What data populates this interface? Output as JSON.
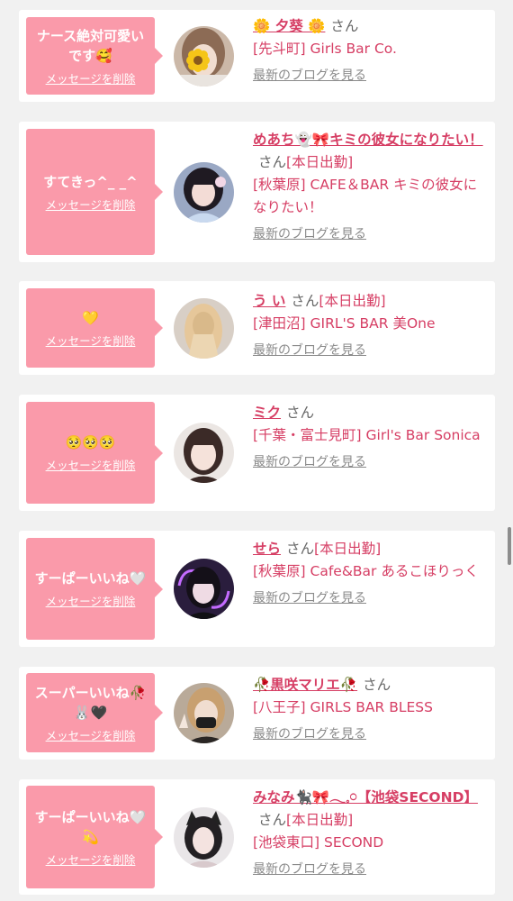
{
  "ui": {
    "delete_label": "メッセージを削除",
    "blog_label": "最新のブログを見る",
    "san": "さん",
    "today_badge": "[本日出勤]"
  },
  "colors": {
    "background": "#f1f1f1",
    "bubble": "#fa9aaa",
    "accent": "#d63e64",
    "muted": "#8a8a8a"
  },
  "items": [
    {
      "message": "ナース絶対可愛いです🥰",
      "name": "🌼 夕葵 🌼",
      "badge": "",
      "shop": "[先斗町] Girls Bar Co.",
      "avatar_icon": "flower-avatar"
    },
    {
      "message": "すてきっ^_ _^",
      "name": "めあち👻🎀キミの彼女になりたい！",
      "badge": "[本日出勤]",
      "shop": "[秋葉原] CAFE＆BAR キミの彼女になりたい！",
      "avatar_icon": "dark-hair-avatar"
    },
    {
      "message": "💛",
      "name": "う い",
      "badge": "[本日出勤]",
      "shop": "[津田沼] GIRL'S BAR 美One",
      "avatar_icon": "blonde-avatar"
    },
    {
      "message": "🥺🥺🥺",
      "name": "ミク",
      "badge": "",
      "shop": "[千葉・富士見町] Girl's Bar Sonica",
      "avatar_icon": "portrait-avatar"
    },
    {
      "message": "すーぱーいいね🤍",
      "name": "せら",
      "badge": "[本日出勤]",
      "shop": "[秋葉原] Cafe&Bar あるこほりっく",
      "avatar_icon": "purple-light-avatar"
    },
    {
      "message": "スーパーいいね🥀🐰🖤",
      "name": "🥀黒咲マリエ🥀",
      "badge": "",
      "shop": "[八王子] GIRLS BAR BLESS",
      "avatar_icon": "masked-avatar"
    },
    {
      "message": "すーぱーいいね🤍💫",
      "name": "みなみ🐈‍⬛🎀𓂃𓈒𓏸【池袋SECOND】",
      "badge": "[本日出勤]",
      "shop": "[池袋東口] SECOND",
      "avatar_icon": "cat-ears-avatar"
    }
  ]
}
